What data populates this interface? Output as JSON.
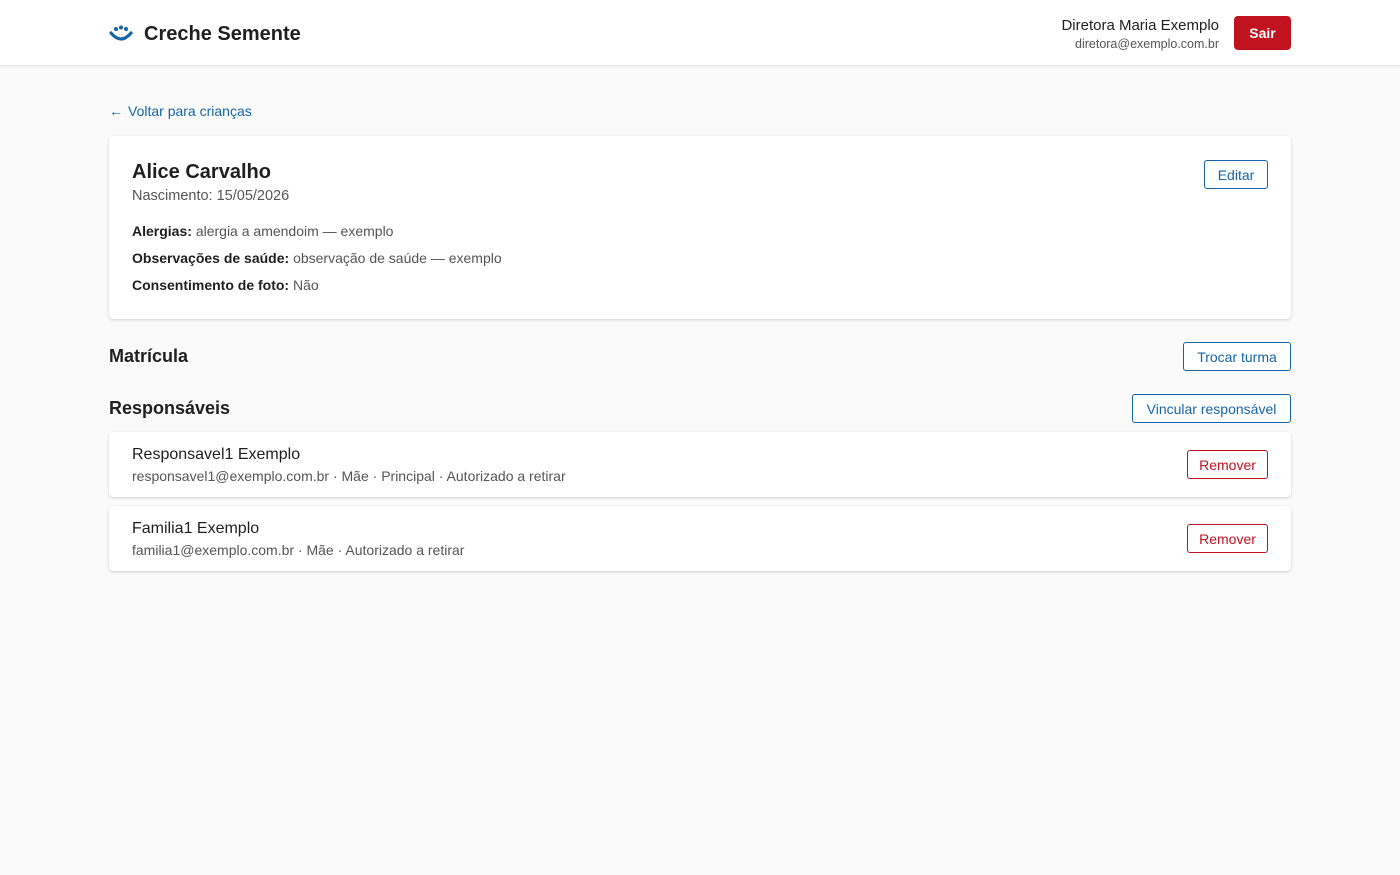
{
  "header": {
    "brand": "Creche Semente",
    "user_name": "Diretora Maria Exemplo",
    "user_email": "diretora@exemplo.com.br",
    "logout_label": "Sair"
  },
  "back_link": {
    "arrow": "←",
    "label": "Voltar para crianças"
  },
  "child": {
    "name": "Alice Carvalho",
    "birth": "Nascimento: 15/05/2026",
    "edit_label": "Editar",
    "fields": [
      {
        "label": "Alergias:",
        "value": "alergia a amendoim — exemplo"
      },
      {
        "label": "Observações de saúde:",
        "value": "observação de saúde — exemplo"
      },
      {
        "label": "Consentimento de foto:",
        "value": "Não"
      }
    ]
  },
  "enrollment": {
    "title": "Matrícula",
    "change_class_label": "Trocar turma"
  },
  "guardians": {
    "title": "Responsáveis",
    "link_label": "Vincular responsável",
    "items": [
      {
        "name": "Responsavel1 Exemplo",
        "meta": "responsavel1@exemplo.com.br · Mãe · Principal · Autorizado a retirar",
        "remove_label": "Remover"
      },
      {
        "name": "Familia1 Exemplo",
        "meta": "familia1@exemplo.com.br · Mãe · Autorizado a retirar",
        "remove_label": "Remover"
      }
    ]
  },
  "colors": {
    "primary": "#1565a6",
    "danger": "#c1121f",
    "background": "#fafafa"
  },
  "icons": {
    "brand": "seed-smile-icon",
    "back": "arrow-left-icon"
  }
}
